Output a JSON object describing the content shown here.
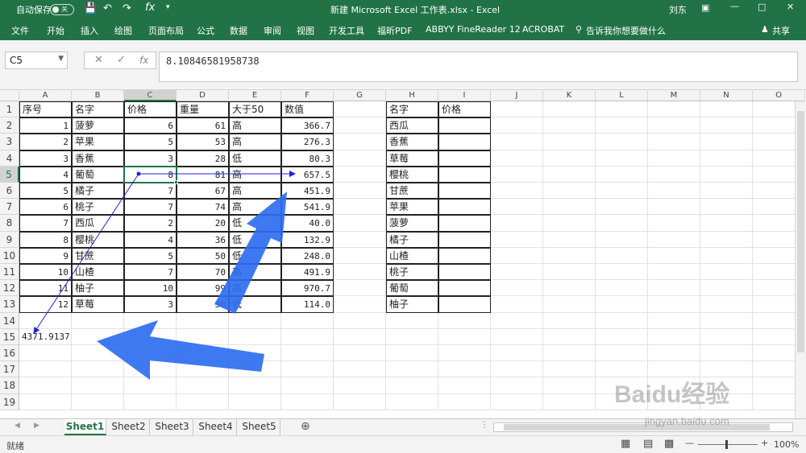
{
  "titlebar": {
    "autosave_label": "自动保存",
    "autosave_state": "关",
    "title": "新建 Microsoft Excel 工作表.xlsx  -  Excel",
    "user": "刘东"
  },
  "ribbon": {
    "tabs": [
      "文件",
      "开始",
      "插入",
      "绘图",
      "页面布局",
      "公式",
      "数据",
      "审阅",
      "视图",
      "开发工具",
      "福昕PDF",
      "ABBYY FineReader 12",
      "ACROBAT"
    ],
    "tell_me": "告诉我你想要做什么",
    "share": "共享"
  },
  "formula_bar": {
    "name_box": "C5",
    "fx": "fx",
    "value": "8.10846581958738"
  },
  "columns": [
    "A",
    "B",
    "C",
    "D",
    "E",
    "F",
    "G",
    "H",
    "I",
    "J",
    "K",
    "L",
    "M",
    "N",
    "O"
  ],
  "rows": [
    "1",
    "2",
    "3",
    "4",
    "5",
    "6",
    "7",
    "8",
    "9",
    "10",
    "11",
    "12",
    "13",
    "14",
    "15",
    "16",
    "17",
    "18",
    "19"
  ],
  "table1": {
    "headers": [
      "序号",
      "名字",
      "价格",
      "重量",
      "大于50",
      "数值"
    ],
    "rows": [
      [
        "1",
        "菠萝",
        "6",
        "61",
        "高",
        "366.7"
      ],
      [
        "2",
        "苹果",
        "5",
        "53",
        "高",
        "276.3"
      ],
      [
        "3",
        "香蕉",
        "3",
        "28",
        "低",
        "80.3"
      ],
      [
        "4",
        "葡萄",
        "8",
        "81",
        "高",
        "657.5"
      ],
      [
        "5",
        "橘子",
        "7",
        "67",
        "高",
        "451.9"
      ],
      [
        "6",
        "桃子",
        "7",
        "74",
        "高",
        "541.9"
      ],
      [
        "7",
        "西瓜",
        "2",
        "20",
        "低",
        "40.0"
      ],
      [
        "8",
        "樱桃",
        "4",
        "36",
        "低",
        "132.9"
      ],
      [
        "9",
        "甘蔗",
        "5",
        "50",
        "低",
        "248.0"
      ],
      [
        "10",
        "山楂",
        "7",
        "70",
        "高",
        "491.9"
      ],
      [
        "11",
        "柚子",
        "10",
        "99",
        "高",
        "970.7"
      ],
      [
        "12",
        "草莓",
        "3",
        "38",
        "低",
        "114.0"
      ]
    ]
  },
  "a15_value": "4371.9137",
  "table2": {
    "headers": [
      "名字",
      "价格"
    ],
    "names": [
      "西瓜",
      "香蕉",
      "草莓",
      "樱桃",
      "甘蔗",
      "苹果",
      "菠萝",
      "橘子",
      "山楂",
      "桃子",
      "葡萄",
      "柚子"
    ]
  },
  "sheets": [
    "Sheet1",
    "Sheet2",
    "Sheet3",
    "Sheet4",
    "Sheet5"
  ],
  "status": {
    "mode": "就绪",
    "zoom": "100%"
  },
  "watermark": {
    "logo": "Baidu经验",
    "url": "jingyan.baidu.com"
  },
  "colors": {
    "excel_green": "#217346",
    "arrow_blue": "#2f6ef0",
    "trace_blue": "#2222dd"
  }
}
